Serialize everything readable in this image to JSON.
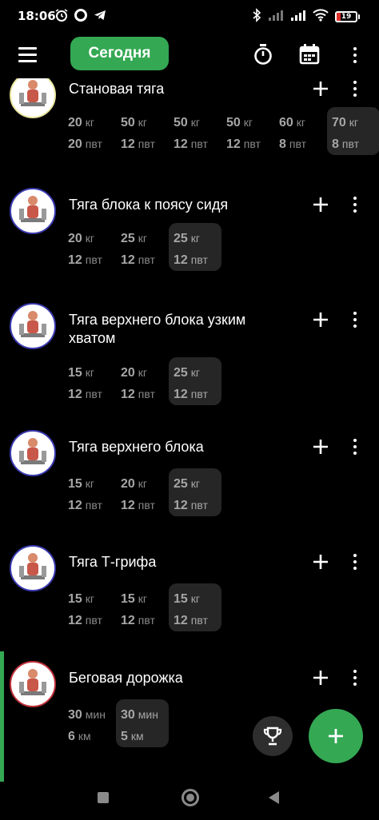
{
  "status_bar": {
    "time": "18:06",
    "battery": "19",
    "battery_level": 0.19,
    "icons": [
      "alarm-icon",
      "circle-app-icon",
      "telegram-icon",
      "bluetooth-icon",
      "signal-icon",
      "signal-icon",
      "wifi-icon",
      "battery-icon"
    ]
  },
  "app_bar": {
    "today_label": "Сегодня",
    "icons": [
      "menu-icon",
      "stopwatch-icon",
      "calendar-icon",
      "more-vertical-icon"
    ]
  },
  "colors": {
    "accent": "#34a853",
    "background": "#000000",
    "set_highlight": "#262626",
    "muted_text": "#a6a6a6"
  },
  "exercises": [
    {
      "name": "Становая тяга",
      "avatar_ring": "#e8e6a0",
      "sets": [
        {
          "v1": "20",
          "u1": "кг",
          "v2": "20",
          "u2": "пвт",
          "highlight": false
        },
        {
          "v1": "50",
          "u1": "кг",
          "v2": "12",
          "u2": "пвт",
          "highlight": false
        },
        {
          "v1": "50",
          "u1": "кг",
          "v2": "12",
          "u2": "пвт",
          "highlight": false
        },
        {
          "v1": "50",
          "u1": "кг",
          "v2": "12",
          "u2": "пвт",
          "highlight": false
        },
        {
          "v1": "60",
          "u1": "кг",
          "v2": "8",
          "u2": "пвт",
          "highlight": false
        },
        {
          "v1": "70",
          "u1": "кг",
          "v2": "8",
          "u2": "пвт",
          "highlight": true
        }
      ]
    },
    {
      "name": "Тяга блока к поясу сидя",
      "avatar_ring": "#3a3ab0",
      "sets": [
        {
          "v1": "20",
          "u1": "кг",
          "v2": "12",
          "u2": "пвт",
          "highlight": false
        },
        {
          "v1": "25",
          "u1": "кг",
          "v2": "12",
          "u2": "пвт",
          "highlight": false
        },
        {
          "v1": "25",
          "u1": "кг",
          "v2": "12",
          "u2": "пвт",
          "highlight": true
        }
      ]
    },
    {
      "name": "Тяга верхнего блока узким хватом",
      "avatar_ring": "#3a3ab0",
      "sets": [
        {
          "v1": "15",
          "u1": "кг",
          "v2": "12",
          "u2": "пвт",
          "highlight": false
        },
        {
          "v1": "20",
          "u1": "кг",
          "v2": "12",
          "u2": "пвт",
          "highlight": false
        },
        {
          "v1": "25",
          "u1": "кг",
          "v2": "12",
          "u2": "пвт",
          "highlight": true
        }
      ]
    },
    {
      "name": "Тяга верхнего блока",
      "avatar_ring": "#3a3ab0",
      "sets": [
        {
          "v1": "15",
          "u1": "кг",
          "v2": "12",
          "u2": "пвт",
          "highlight": false
        },
        {
          "v1": "20",
          "u1": "кг",
          "v2": "12",
          "u2": "пвт",
          "highlight": false
        },
        {
          "v1": "25",
          "u1": "кг",
          "v2": "12",
          "u2": "пвт",
          "highlight": true
        }
      ]
    },
    {
      "name": "Тяга Т-грифа",
      "avatar_ring": "#3a3ab0",
      "sets": [
        {
          "v1": "15",
          "u1": "кг",
          "v2": "12",
          "u2": "пвт",
          "highlight": false
        },
        {
          "v1": "15",
          "u1": "кг",
          "v2": "12",
          "u2": "пвт",
          "highlight": false
        },
        {
          "v1": "15",
          "u1": "кг",
          "v2": "12",
          "u2": "пвт",
          "highlight": true
        }
      ]
    },
    {
      "name": "Беговая дорожка",
      "avatar_ring": "#c0303a",
      "active": true,
      "sets": [
        {
          "v1": "30",
          "u1": "мин",
          "v2": "6",
          "u2": "км",
          "highlight": false
        },
        {
          "v1": "30",
          "u1": "мин",
          "v2": "5",
          "u2": "км",
          "highlight": true
        }
      ]
    }
  ],
  "fabs": {
    "trophy_icon": "trophy-icon",
    "add_icon": "plus-icon"
  },
  "nav_bar": {
    "icons": [
      "recents-square-icon",
      "home-circle-icon",
      "back-triangle-icon"
    ]
  }
}
